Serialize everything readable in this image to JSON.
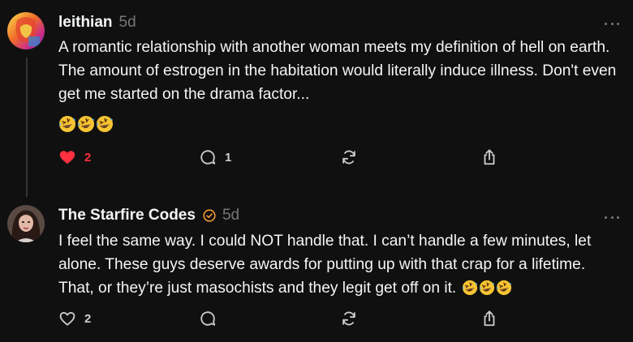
{
  "colors": {
    "background": "#101010",
    "text": "#f3f5f7",
    "muted": "#777777",
    "like": "#ff3040",
    "verified": "#f39a36"
  },
  "posts": [
    {
      "username": "leithian",
      "time": "5d",
      "verified": false,
      "body": "A romantic relationship with another woman meets my definition of hell on earth. The amount of estrogen in the habitation would literally induce illness. Don't even get me started on the drama factor...",
      "emoji": [
        "rolling-on-floor-laughing",
        "rolling-on-floor-laughing",
        "rolling-on-floor-laughing"
      ],
      "like_count": "2",
      "liked": true,
      "reply_count": "1",
      "icons": {
        "like": "heart-filled-icon",
        "reply": "comment-icon",
        "repost": "repost-icon",
        "share": "share-icon",
        "more": "more-icon"
      }
    },
    {
      "username": "The Starfire Codes",
      "time": "5d",
      "verified": true,
      "body": "I feel the same way. I could NOT handle that. I can’t handle a few minutes, let alone. These guys deserve awards for putting up with that crap for a lifetime. That, or they’re just masochists and they legit get off on it.",
      "emoji": [
        "rolling-on-floor-laughing",
        "rolling-on-floor-laughing",
        "rolling-on-floor-laughing"
      ],
      "like_count": "2",
      "liked": false,
      "reply_count": "",
      "icons": {
        "like": "heart-outline-icon",
        "reply": "comment-icon",
        "repost": "repost-icon",
        "share": "share-icon",
        "more": "more-icon",
        "verified": "verified-badge-icon"
      }
    }
  ]
}
